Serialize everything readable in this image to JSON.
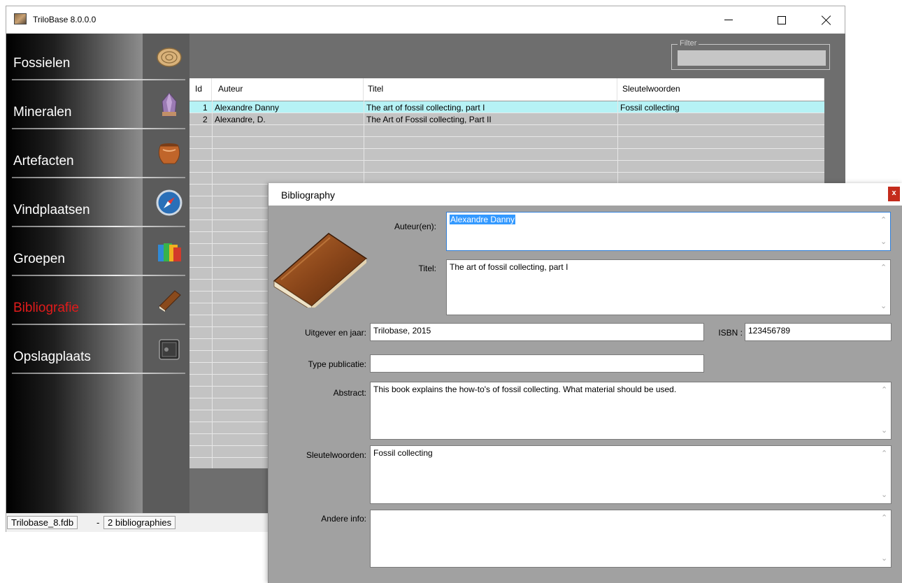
{
  "window": {
    "title": "TriloBase 8.0.0.0"
  },
  "nav": {
    "items": [
      {
        "label": "Fossielen",
        "icon": "ammonite-icon"
      },
      {
        "label": "Mineralen",
        "icon": "amethyst-crystal-icon"
      },
      {
        "label": "Artefacten",
        "icon": "pottery-vase-icon"
      },
      {
        "label": "Vindplaatsen",
        "icon": "compass-icon"
      },
      {
        "label": "Groepen",
        "icon": "folders-icon"
      },
      {
        "label": "Bibliografie",
        "icon": "book-icon"
      },
      {
        "label": "Opslagplaats",
        "icon": "safe-icon"
      }
    ],
    "active_index": 5,
    "active_color": "#e01b1b"
  },
  "filter": {
    "label": "Filter",
    "value": ""
  },
  "grid": {
    "columns": [
      "Id",
      "Auteur",
      "Titel",
      "Sleutelwoorden"
    ],
    "rows": [
      {
        "id": "1",
        "auteur": "Alexandre Danny",
        "titel": "The art of fossil collecting, part I",
        "sleutelwoorden": "Fossil collecting"
      },
      {
        "id": "2",
        "auteur": "Alexandre, D.",
        "titel": "The Art of Fossil collecting, Part II",
        "sleutelwoorden": ""
      }
    ],
    "selected_row_color": "#b6f2f5"
  },
  "status": {
    "file": "Trilobase_8.fdb",
    "separator": "-",
    "count": "2 bibliographies"
  },
  "dialog": {
    "title": "Bibliography",
    "close": "x",
    "fields": {
      "auteur_label": "Auteur(en):",
      "auteur_value": "Alexandre Danny",
      "titel_label": "Titel:",
      "titel_value": "The art of fossil collecting, part I",
      "uitgever_label": "Uitgever en jaar:",
      "uitgever_value": "Trilobase, 2015",
      "isbn_label": "ISBN :",
      "isbn_value": "123456789",
      "type_label": "Type publicatie:",
      "type_value": "",
      "abstract_label": "Abstract:",
      "abstract_value": "This book explains the how-to's of fossil collecting. What material should be used.",
      "sleutel_label": "Sleutelwoorden:",
      "sleutel_value": "Fossil collecting",
      "andere_label": "Andere info:",
      "andere_value": ""
    }
  }
}
